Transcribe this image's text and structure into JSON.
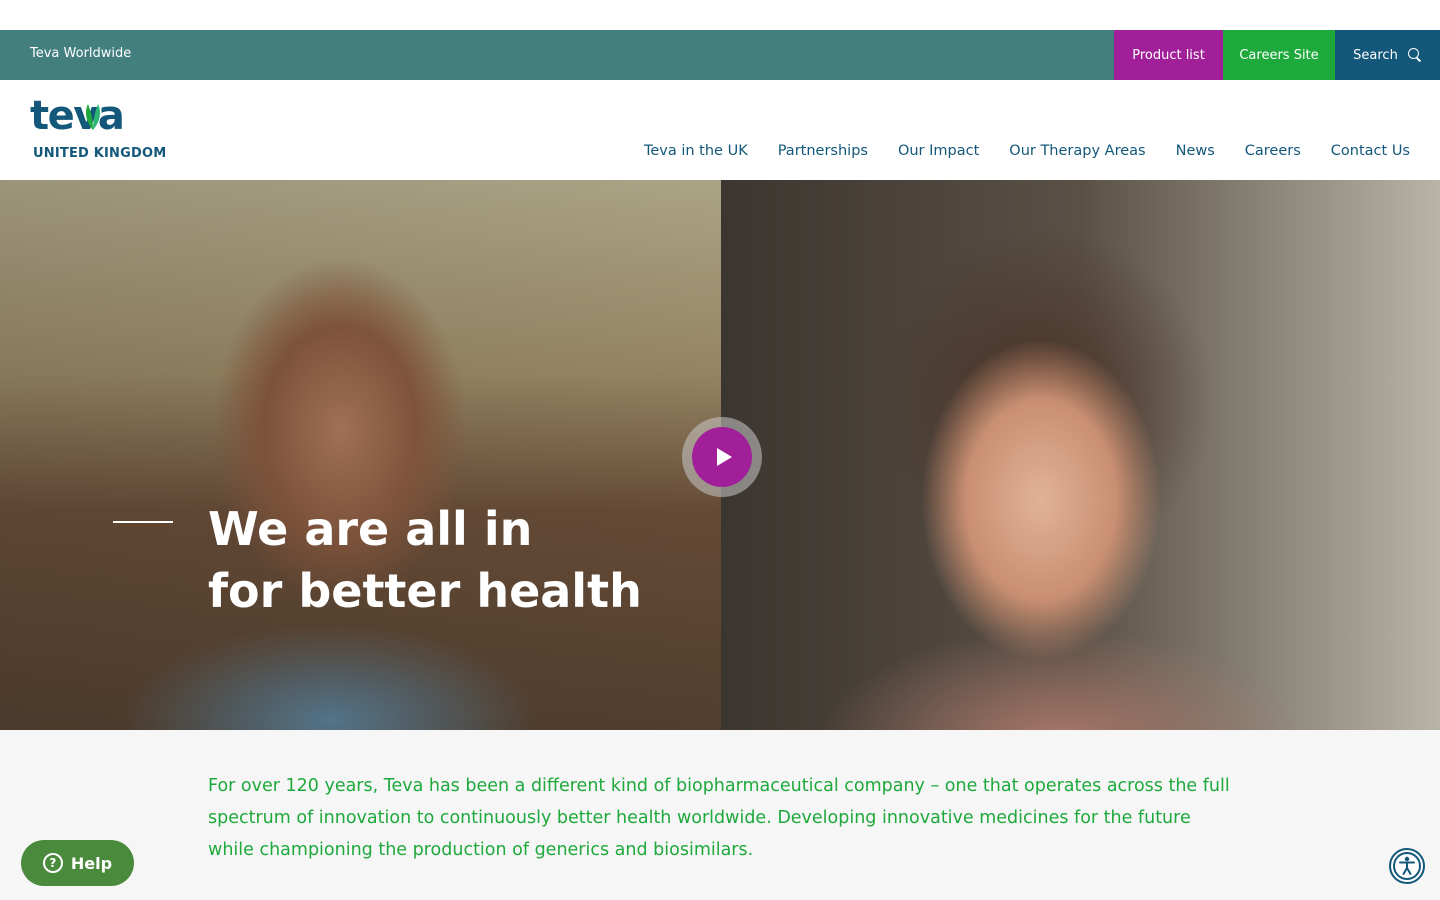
{
  "utility_bar": {
    "worldwide_link": "Teva Worldwide",
    "product_list": "Product list",
    "careers_site": "Careers Site",
    "search": "Search",
    "colors": {
      "bar": "#437f7e",
      "product": "#a1209a",
      "careers": "#1ea93c",
      "search": "#13577a"
    }
  },
  "header": {
    "logo_text": "teva",
    "country": "UNITED KINGDOM",
    "nav": [
      "Teva in the UK",
      "Partnerships",
      "Our Impact",
      "Our Therapy Areas",
      "News",
      "Careers",
      "Contact Us"
    ]
  },
  "hero": {
    "title_line1": "We are all in",
    "title_line2": "for better health",
    "play_icon": "play-icon"
  },
  "intro": {
    "text": "For over 120 years, Teva has been a different kind of biopharmaceutical company – one that operates across the full spectrum of innovation to continuously better health worldwide. Developing innovative medicines for the future while championing the production of generics and biosimilars."
  },
  "widgets": {
    "help_label": "Help",
    "help_icon": "question-icon",
    "accessibility_icon": "accessibility-icon"
  }
}
